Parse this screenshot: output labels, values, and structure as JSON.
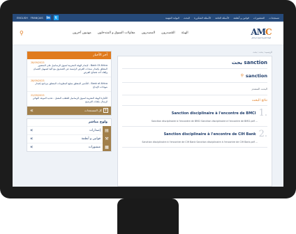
{
  "topbar": {
    "lang_en": "ENGLISH",
    "lang_fr": "FRANÇAIS",
    "social_linkedin": "in",
    "social_twitter": "t",
    "links": [
      "البوابة المهنية",
      "البحث",
      "الأسئلة المتكررة",
      "الأسئلة العامة",
      "قوانين و أنظمة",
      "المنشورات",
      "مستجدات"
    ]
  },
  "header": {
    "logo_text_left": "AM",
    "logo_text_right": "C",
    "logo_sub": "الهيئة المغربية لسوق الرساميل",
    "nav": [
      "الهيئة",
      "المُصدرون",
      "المصدرون",
      "مقاولات السوق و المتدخلون",
      "مهنيون آخرون"
    ]
  },
  "breadcrumb": "الرئيسية / بحث / بحث",
  "main": {
    "title": "بحث sanction",
    "search_value": "sanction",
    "sub_label": "البحث المتقدم",
    "results_label": "نتائج البحث",
    "results": [
      {
        "num": "1.",
        "title": "Sanction disciplinaire à l'encontre de BMCI",
        "snippet": "Sanction disciplinaire à l'encontre de BMCI Sanction disciplinaire à l'encontre de BMCI.pdf ..."
      },
      {
        "num": "2.",
        "title": "Sanction disciplinaire à l'encontre de CIH Bank",
        "snippet": "Sanction disciplinaire à l'encontre de CIH Bank Sanction disciplinaire à l'encontre de CIH Bank.pdf ..."
      }
    ]
  },
  "sidebar": {
    "news_title": "آخر الأخبار",
    "news": [
      {
        "date": "28/09/2023",
        "text": "Bank Of Africa - لإتمام الهيئة المغربية لسوق الرساميل على المنشور المتعلق بإصدار سندات القرض الرئيسة عن الصندوق مع آلية لتسهيل الضمان وإلغاء أحد فصائح القرض"
      },
      {
        "date": "28/09/2023",
        "text": "Bank of Africa - التأشير المتعلق بتبليغ المعلومات المتعلق ببرنامج إصدار شهادات الإيداع"
      },
      {
        "date": "22/09/2023",
        "text": "الكبارة الهيئة المغربية لسوق الرساميل للقطب المقبل - تحديد الموعد النهائي لإرسال ملفات الترشيح"
      }
    ],
    "news_more": "كل المستجدات",
    "quick_title": "ولوج مباشر",
    "quick_items": [
      "إصدارات",
      "قوانين و أنظمة",
      "منشورات"
    ]
  }
}
